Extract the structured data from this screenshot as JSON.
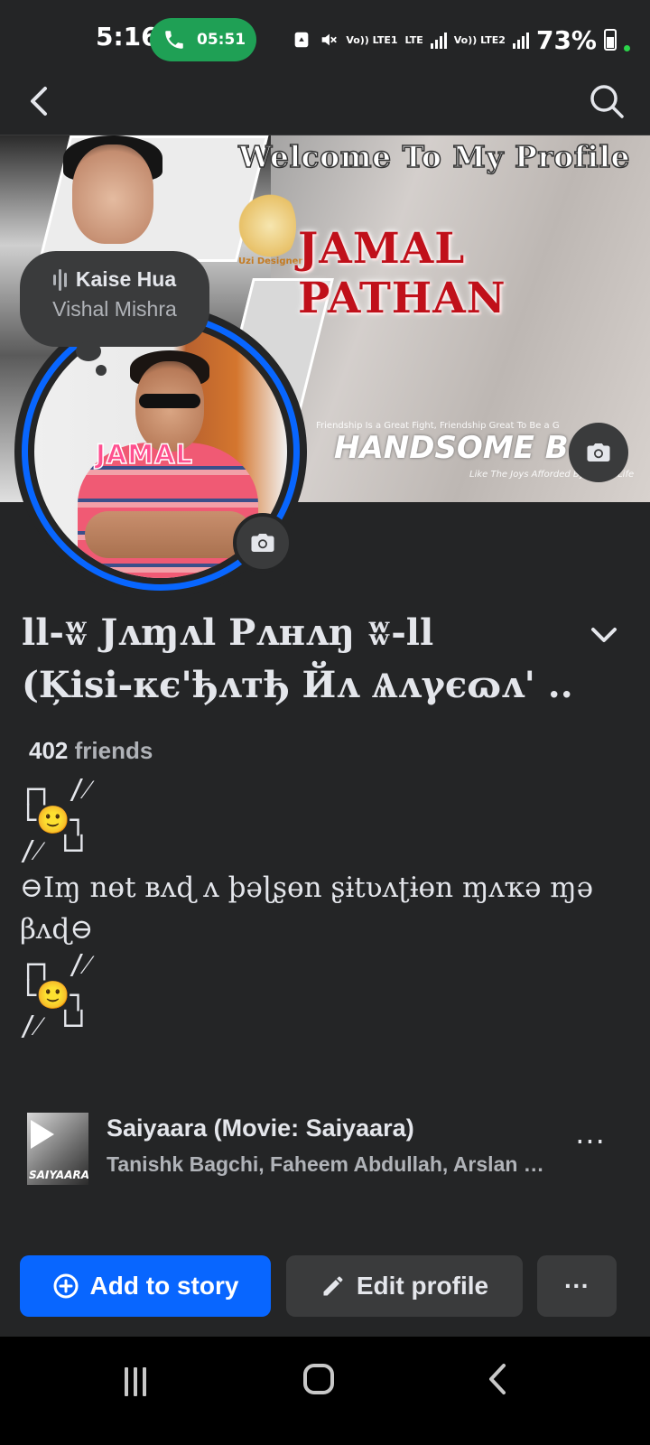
{
  "status_bar": {
    "time": "5:16",
    "call_timer": "05:51",
    "net1": "Vo)) LTE1",
    "net1_top": "LTE",
    "net2": "Vo)) LTE2",
    "battery": "73%"
  },
  "header": {
    "back_icon": "arrow-back-icon",
    "search_icon": "search-icon"
  },
  "cover": {
    "welcome": "Welcome To My Profile",
    "name": "JAMAL PATHAN",
    "logo_text": "Uzi Designer",
    "tagline": "HANDSOME BOY",
    "small1": "Friendship Is a Great Fight, Friendship Great To Be a G",
    "small2": "Like The Joys Afforded By Art Or Life"
  },
  "avatar": {
    "label": "JAMAL"
  },
  "music_bubble": {
    "title": "Kaise Hua",
    "artist": "Vishal Mishra"
  },
  "profile": {
    "name_line1": "ll-ʬ Jʌɱʌl Pʌнʌŋ ʬ-ll",
    "name_line2": "(Ķisi-кє'ђʌтђ Йʌ Ѧʌγєɷʌ' ..",
    "friends_count": "402",
    "friends_label": "friends"
  },
  "bio": {
    "deco_top": "┌┐ /⁄\n└🙂┐\n/⁄ └┘",
    "line": "⊖Iɱ nɵt вʌɖ ʌ þəɭʂɵn ʂɨtʋʌʈɨɵn ɱʌҡə ɱə βʌɖ⊖",
    "deco_bottom": "┌┐ /⁄\n└🙂┐\n/⁄ └┘"
  },
  "song": {
    "title": "Saiyaara (Movie: Saiyaara)",
    "artists": "Tanishk Bagchi, Faheem Abdullah, Arslan Nizami",
    "thumb_label": "SAIYAARA",
    "more": "···"
  },
  "actions": {
    "add_story": "Add to story",
    "edit_profile": "Edit profile",
    "more": "···"
  },
  "colors": {
    "accent": "#0866ff",
    "background": "#242526",
    "surface": "#3a3b3c",
    "call_green": "#1fa055"
  }
}
